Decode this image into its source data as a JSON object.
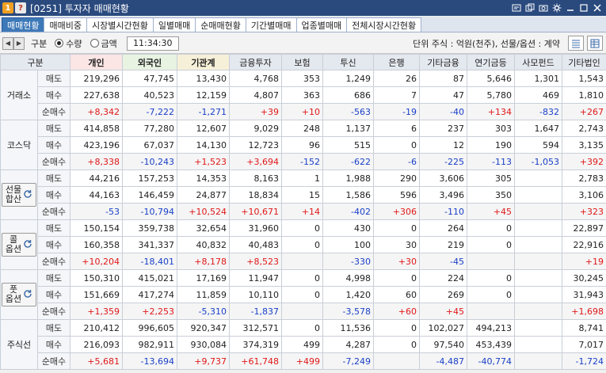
{
  "window": {
    "num_badge": "1",
    "help_badge": "?",
    "title": "[0251] 투자자 매매현황"
  },
  "tabs": [
    {
      "label": "매매현황",
      "active": true
    },
    {
      "label": "매매비중",
      "active": false
    },
    {
      "label": "시장별시간현황",
      "active": false
    },
    {
      "label": "일별매매",
      "active": false
    },
    {
      "label": "순매매현황",
      "active": false
    },
    {
      "label": "기간별매매",
      "active": false
    },
    {
      "label": "업종별매매",
      "active": false
    },
    {
      "label": "전체시장시간현황",
      "active": false
    }
  ],
  "toolbar": {
    "label": "구분",
    "radio_qty": "수량",
    "radio_amt": "금액",
    "selected": "qty",
    "time": "11:34:30",
    "unit_text": "단위 주식 : 억원(천주), 선물/옵션 : 계약"
  },
  "columns": [
    "구분",
    "",
    "개인",
    "외국인",
    "기관계",
    "금융투자",
    "보험",
    "투신",
    "은행",
    "기타금융",
    "연기금등",
    "사모펀드",
    "기타법인"
  ],
  "row_labels": {
    "sell": "매도",
    "buy": "매수",
    "net": "순매수"
  },
  "markets": [
    {
      "name": "거래소",
      "button": false,
      "sell": [
        "219,296",
        "47,745",
        "13,430",
        "4,768",
        "353",
        "1,249",
        "26",
        "87",
        "5,646",
        "1,301",
        "1,543"
      ],
      "buy": [
        "227,638",
        "40,523",
        "12,159",
        "4,807",
        "363",
        "686",
        "7",
        "47",
        "5,780",
        "469",
        "1,810"
      ],
      "net": [
        "+8,342",
        "-7,222",
        "-1,271",
        "+39",
        "+10",
        "-563",
        "-19",
        "-40",
        "+134",
        "-832",
        "+267"
      ]
    },
    {
      "name": "코스닥",
      "button": false,
      "sell": [
        "414,858",
        "77,280",
        "12,607",
        "9,029",
        "248",
        "1,137",
        "6",
        "237",
        "303",
        "1,647",
        "2,743"
      ],
      "buy": [
        "423,196",
        "67,037",
        "14,130",
        "12,723",
        "96",
        "515",
        "0",
        "12",
        "190",
        "594",
        "3,135"
      ],
      "net": [
        "+8,338",
        "-10,243",
        "+1,523",
        "+3,694",
        "-152",
        "-622",
        "-6",
        "-225",
        "-113",
        "-1,053",
        "+392"
      ]
    },
    {
      "name": "선물\n합산",
      "button": true,
      "sell": [
        "44,216",
        "157,253",
        "14,353",
        "8,163",
        "1",
        "1,988",
        "290",
        "3,606",
        "305",
        "",
        "2,783"
      ],
      "buy": [
        "44,163",
        "146,459",
        "24,877",
        "18,834",
        "15",
        "1,586",
        "596",
        "3,496",
        "350",
        "",
        "3,106"
      ],
      "net": [
        "-53",
        "-10,794",
        "+10,524",
        "+10,671",
        "+14",
        "-402",
        "+306",
        "-110",
        "+45",
        "",
        "+323"
      ]
    },
    {
      "name": "콜\n옵션",
      "button": true,
      "sell": [
        "150,154",
        "359,738",
        "32,654",
        "31,960",
        "0",
        "430",
        "0",
        "264",
        "0",
        "",
        "22,897"
      ],
      "buy": [
        "160,358",
        "341,337",
        "40,832",
        "40,483",
        "0",
        "100",
        "30",
        "219",
        "0",
        "",
        "22,916"
      ],
      "net": [
        "+10,204",
        "-18,401",
        "+8,178",
        "+8,523",
        "",
        "-330",
        "+30",
        "-45",
        "",
        "",
        "+19"
      ]
    },
    {
      "name": "풋\n옵션",
      "button": true,
      "sell": [
        "150,310",
        "415,021",
        "17,169",
        "11,947",
        "0",
        "4,998",
        "0",
        "224",
        "0",
        "",
        "30,245"
      ],
      "buy": [
        "151,669",
        "417,274",
        "11,859",
        "10,110",
        "0",
        "1,420",
        "60",
        "269",
        "0",
        "",
        "31,943"
      ],
      "net": [
        "+1,359",
        "+2,253",
        "-5,310",
        "-1,837",
        "",
        "-3,578",
        "+60",
        "+45",
        "",
        "",
        "+1,698"
      ]
    },
    {
      "name": "주식선",
      "button": false,
      "sell": [
        "210,412",
        "996,605",
        "920,347",
        "312,571",
        "0",
        "11,536",
        "0",
        "102,027",
        "494,213",
        "",
        "8,741"
      ],
      "buy": [
        "216,093",
        "982,911",
        "930,084",
        "374,319",
        "499",
        "4,287",
        "0",
        "97,540",
        "453,439",
        "",
        "7,017"
      ],
      "net": [
        "+5,681",
        "-13,694",
        "+9,737",
        "+61,748",
        "+499",
        "-7,249",
        "",
        "-4,487",
        "-40,774",
        "",
        "-1,724"
      ]
    }
  ],
  "colors": {
    "titlebar": "#2a4a7e",
    "active_tab": "#3d78b8",
    "positive": "#e01818",
    "negative": "#1a40c8"
  },
  "icons": {
    "refresh": "refresh-icon",
    "prev": "prev-icon",
    "next": "next-icon"
  }
}
